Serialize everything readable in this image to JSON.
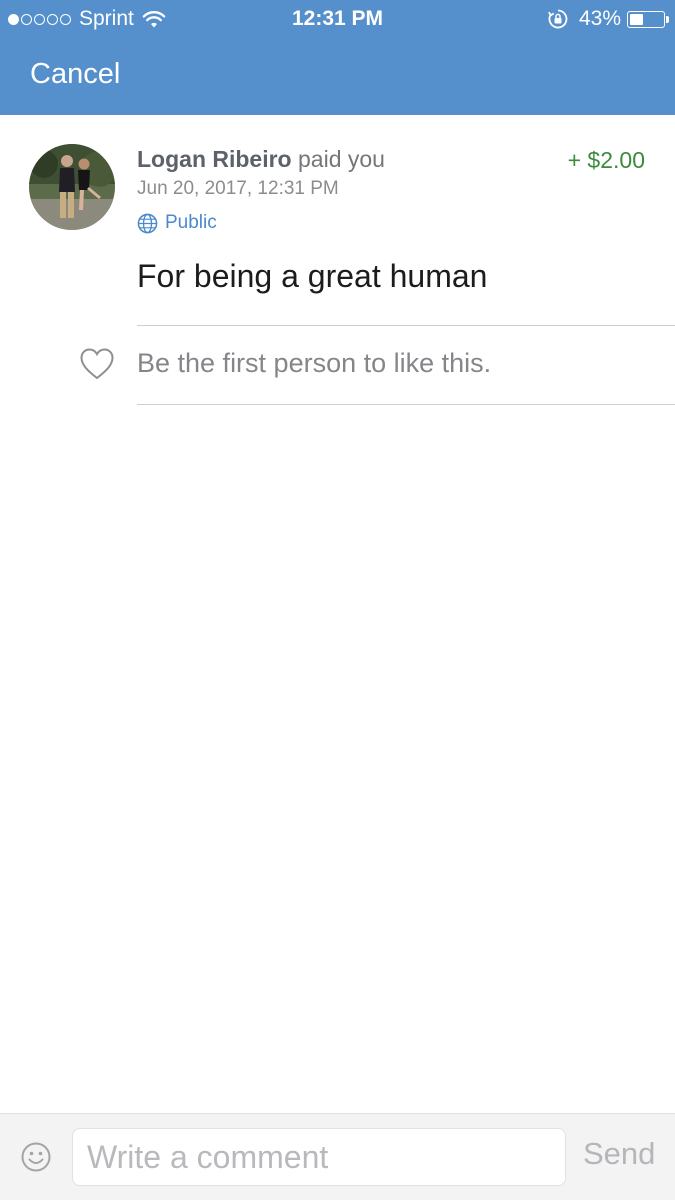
{
  "status_bar": {
    "signal_bars_filled": 1,
    "signal_bars_total": 5,
    "carrier": "Sprint",
    "time": "12:31 PM",
    "battery_percent": "43%",
    "battery_level": 0.43
  },
  "header": {
    "cancel_label": "Cancel"
  },
  "payment": {
    "payer_name": "Logan Ribeiro",
    "action": "paid you",
    "amount": "+ $2.00",
    "date": "Jun 20, 2017, 12:31 PM",
    "privacy": "Public",
    "note": "For being a great human"
  },
  "likes": {
    "text": "Be the first person to like this."
  },
  "comment_bar": {
    "placeholder": "Write a comment",
    "send_label": "Send"
  },
  "colors": {
    "header_blue": "#5590cc",
    "amount_green": "#3b8a3e",
    "link_blue": "#4a8acc"
  }
}
